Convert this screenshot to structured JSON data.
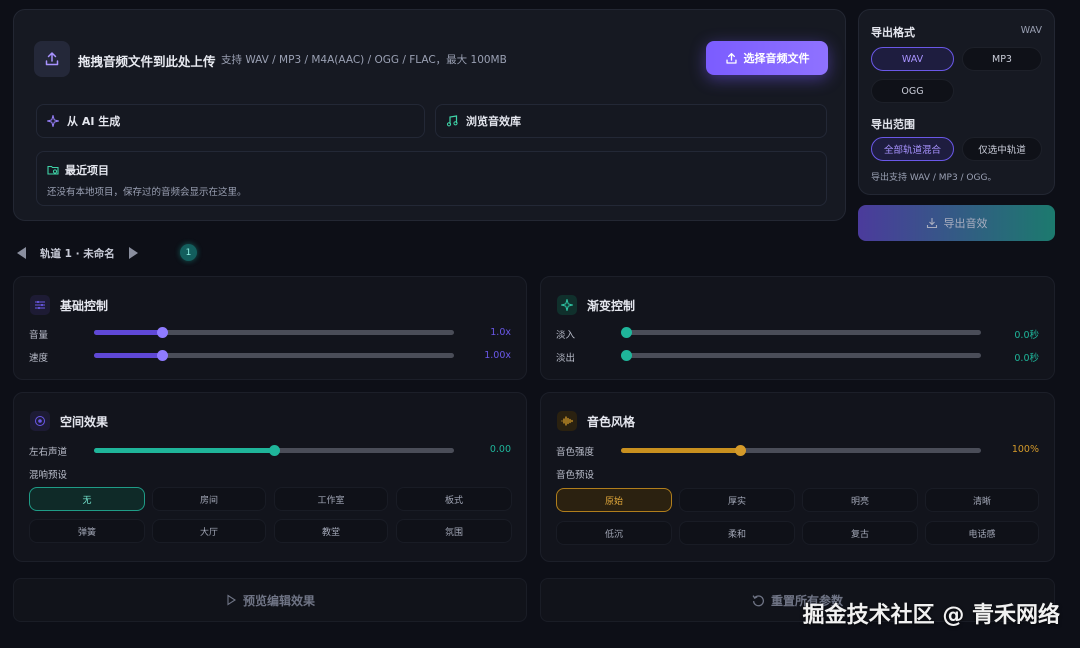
{
  "upload": {
    "title": "拖拽音频文件到此处上传",
    "hint": "支持 WAV / MP3 / M4A(AAC) / OGG / FLAC，最大 100MB",
    "choose_label": "选择音频文件",
    "ai_label": "从 AI 生成",
    "library_label": "浏览音效库",
    "recent_title": "最近项目",
    "recent_desc": "还没有本地项目，保存过的音频会显示在这里。"
  },
  "export": {
    "format_title": "导出格式",
    "format_current": "WAV",
    "formats": [
      "WAV",
      "MP3",
      "OGG"
    ],
    "range_title": "导出范围",
    "ranges": [
      "全部轨道混合",
      "仅选中轨道"
    ],
    "note": "导出支持 WAV / MP3 / OGG。",
    "button_label": "导出音效"
  },
  "track": {
    "name": "轨道 1 · 未命名",
    "count": "1"
  },
  "basic": {
    "title": "基础控制",
    "volume_label": "音量",
    "volume_value": "1.0x",
    "volume_fraction": 0.19,
    "speed_label": "速度",
    "speed_value": "1.00x",
    "speed_fraction": 0.19
  },
  "fade": {
    "title": "渐变控制",
    "in_label": "淡入",
    "in_value": "0.0秒",
    "in_fraction": 0.0,
    "out_label": "淡出",
    "out_value": "0.0秒",
    "out_fraction": 0.0
  },
  "space": {
    "title": "空间效果",
    "pan_label": "左右声道",
    "pan_value": "0.00",
    "pan_fraction": 0.5,
    "reverb_label": "混响预设",
    "reverb_presets": [
      "无",
      "房间",
      "工作室",
      "板式",
      "弹簧",
      "大厅",
      "教堂",
      "氛围"
    ]
  },
  "tone": {
    "title": "音色风格",
    "strength_label": "音色强度",
    "strength_value": "100%",
    "strength_fraction": 0.33,
    "preset_label": "音色预设",
    "presets": [
      "原始",
      "厚实",
      "明亮",
      "清晰",
      "低沉",
      "柔和",
      "复古",
      "电话感"
    ]
  },
  "actions": {
    "preview_label": "预览编辑效果",
    "reset_label": "重置所有参数"
  },
  "watermark": "掘金技术社区 @ 青禾网络",
  "colors": {
    "accent_purple": "#7b5cff",
    "accent_teal": "#1fb59a",
    "accent_gold": "#d49a2a"
  }
}
